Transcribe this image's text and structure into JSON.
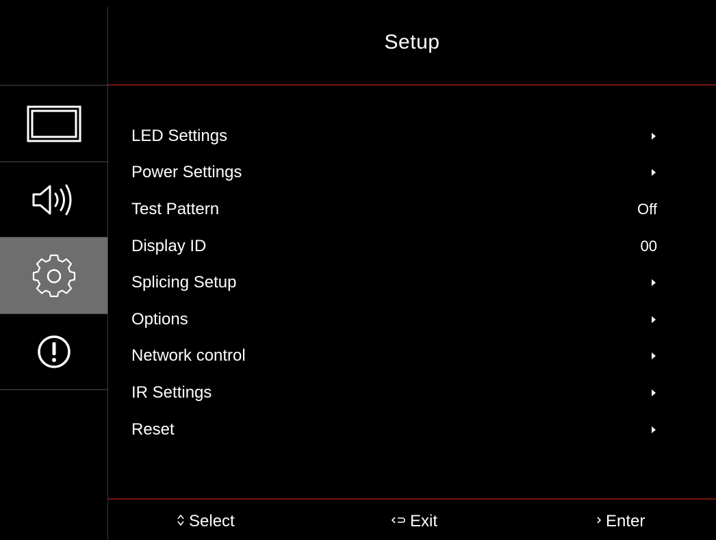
{
  "header": {
    "title": "Setup"
  },
  "sidebar": {
    "tabs": [
      {
        "icon": "display-icon",
        "active": false
      },
      {
        "icon": "speaker-icon",
        "active": false
      },
      {
        "icon": "gear-icon",
        "active": true
      },
      {
        "icon": "info-icon",
        "active": false
      }
    ]
  },
  "menu": {
    "items": [
      {
        "label": "LED Settings",
        "value": "",
        "submenu": true
      },
      {
        "label": "Power Settings",
        "value": "",
        "submenu": true
      },
      {
        "label": "Test Pattern",
        "value": "Off",
        "submenu": false
      },
      {
        "label": "Display ID",
        "value": "00",
        "submenu": false
      },
      {
        "label": "Splicing Setup",
        "value": "",
        "submenu": true
      },
      {
        "label": "Options",
        "value": "",
        "submenu": true
      },
      {
        "label": "Network control",
        "value": "",
        "submenu": true
      },
      {
        "label": "IR Settings",
        "value": "",
        "submenu": true
      },
      {
        "label": "Reset",
        "value": "",
        "submenu": true
      }
    ]
  },
  "footer": {
    "select": {
      "glyph": "⌃⌄",
      "label": "Select"
    },
    "exit": {
      "glyph": "‹⊃",
      "label": "Exit"
    },
    "enter": {
      "glyph": "›",
      "label": "Enter"
    }
  },
  "colors": {
    "accent_line": "#7a1414",
    "active_tab": "#6e6e6e",
    "text": "#ffffff",
    "background": "#000000"
  }
}
